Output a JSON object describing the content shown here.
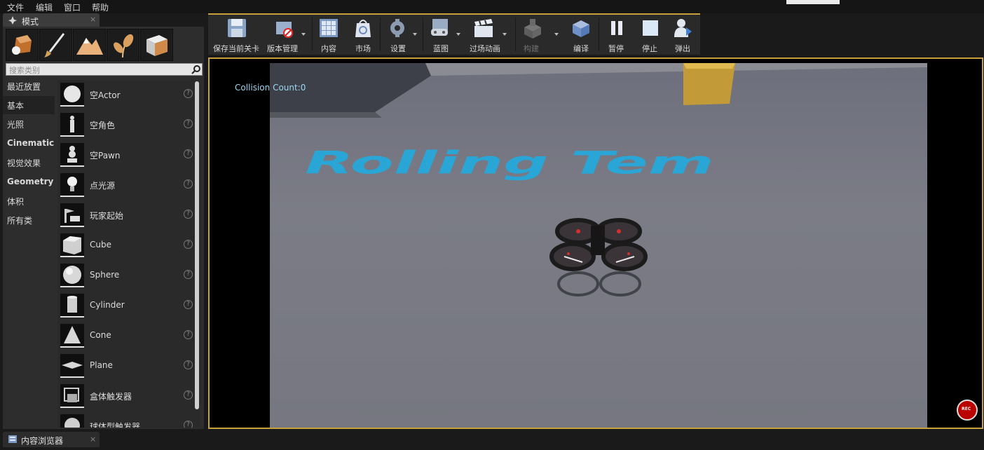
{
  "menu": [
    "文件",
    "编辑",
    "窗口",
    "帮助"
  ],
  "modes_tab": {
    "label": "模式"
  },
  "search": {
    "placeholder": "搜索类别"
  },
  "categories": [
    "最近放置",
    "基本",
    "光照",
    "Cinematic",
    "视觉效果",
    "Geometry",
    "体积",
    "所有类"
  ],
  "active_category": "基本",
  "place_items": [
    "空Actor",
    "空角色",
    "空Pawn",
    "点光源",
    "玩家起始",
    "Cube",
    "Sphere",
    "Cylinder",
    "Cone",
    "Plane",
    "盒体触发器",
    "球体型触发器"
  ],
  "toolbar": [
    {
      "label": "保存当前关卡",
      "icon": "save-icon"
    },
    {
      "label": "版本管理",
      "icon": "source-control-icon"
    },
    {
      "label": "内容",
      "icon": "content-icon"
    },
    {
      "label": "市场",
      "icon": "marketplace-icon"
    },
    {
      "label": "设置",
      "icon": "settings-icon"
    },
    {
      "label": "蓝图",
      "icon": "blueprint-icon"
    },
    {
      "label": "过场动画",
      "icon": "cinematics-icon"
    },
    {
      "label": "构建",
      "icon": "build-icon"
    },
    {
      "label": "编译",
      "icon": "compile-icon"
    },
    {
      "label": "暂停",
      "icon": "pause-icon"
    },
    {
      "label": "停止",
      "icon": "stop-icon"
    },
    {
      "label": "弹出",
      "icon": "eject-icon"
    }
  ],
  "viewport": {
    "collision_text": "Collision Count:0",
    "floor_text": "Rolling Tem",
    "rec_label": "REC"
  },
  "bottom_tab": {
    "label": "内容浏览器"
  },
  "colors": {
    "accent": "#c7a13b",
    "floor_text": "#29a6d6",
    "rec": "#b00000"
  }
}
